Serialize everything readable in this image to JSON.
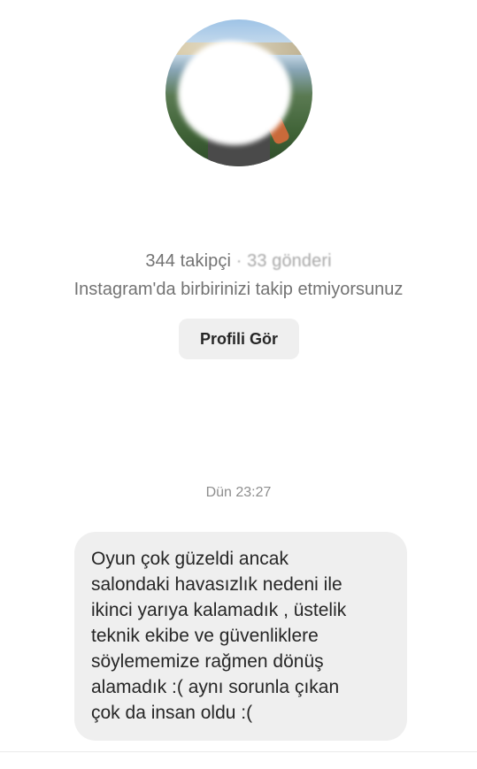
{
  "profile": {
    "avatar_icon": "profile-photo",
    "followers": "344 takipçi",
    "separator": " · ",
    "posts": "33 gönderi",
    "mutual_text": "Instagram'da birbirinizi takip etmiyorsunuz",
    "view_profile_label": "Profili Gör"
  },
  "thread": {
    "timestamp": "Dün 23:27",
    "message_lines": [
      "Oyun çok güzeldi ancak",
      "salondaki havasızlık nedeni ile",
      "ikinci yarıya kalamadık , üstelik",
      "teknik ekibe ve güvenliklere",
      "söylememize rağmen dönüş",
      "alamadık :( aynı sorunla çıkan",
      "çok da insan oldu :("
    ]
  },
  "colors": {
    "bubble_bg": "#efefef",
    "secondary_text": "#737373",
    "timestamp_text": "#8e8e8e"
  }
}
